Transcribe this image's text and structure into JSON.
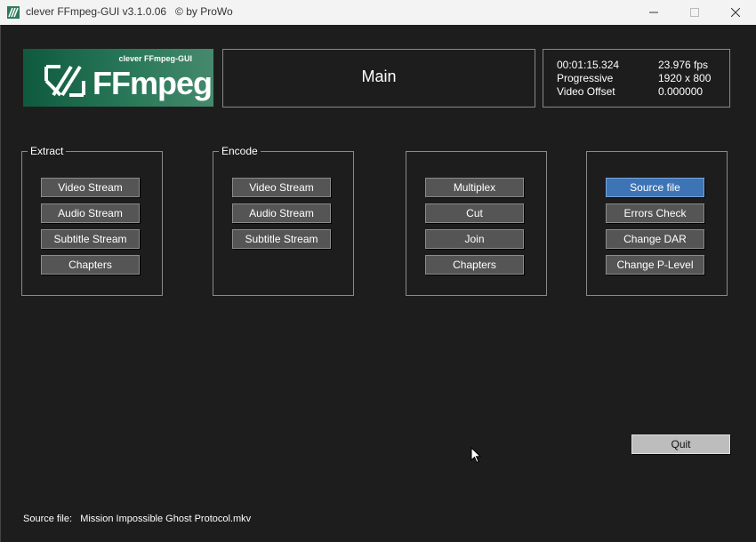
{
  "window": {
    "title": "clever FFmpeg-GUI v3.1.0.06   © by ProWo"
  },
  "logo": {
    "subtitle": "clever FFmpeg-GUI",
    "name": "FFmpeg"
  },
  "main": {
    "title": "Main"
  },
  "info": {
    "duration": "00:01:15.324",
    "fps": "23.976 fps",
    "scan": "Progressive",
    "resolution": "1920 x 800",
    "offset_label": "Video Offset",
    "offset_value": "0.000000"
  },
  "extract": {
    "label": "Extract",
    "buttons": [
      "Video Stream",
      "Audio Stream",
      "Subtitle Stream",
      "Chapters"
    ]
  },
  "encode": {
    "label": "Encode",
    "buttons": [
      "Video Stream",
      "Audio Stream",
      "Subtitle Stream"
    ]
  },
  "tools": {
    "buttons": [
      "Multiplex",
      "Cut",
      "Join",
      "Chapters"
    ]
  },
  "source": {
    "buttons": [
      "Source file",
      "Errors Check",
      "Change DAR",
      "Change P-Level"
    ],
    "selected": "Source file"
  },
  "quit_label": "Quit",
  "status": {
    "label": "Source file:",
    "value": "Mission Impossible Ghost Protocol.mkv"
  },
  "colors": {
    "background": "#1d1d1d",
    "button": "#555555",
    "selected": "#3d74b5",
    "logo": "#2b7a5a"
  }
}
